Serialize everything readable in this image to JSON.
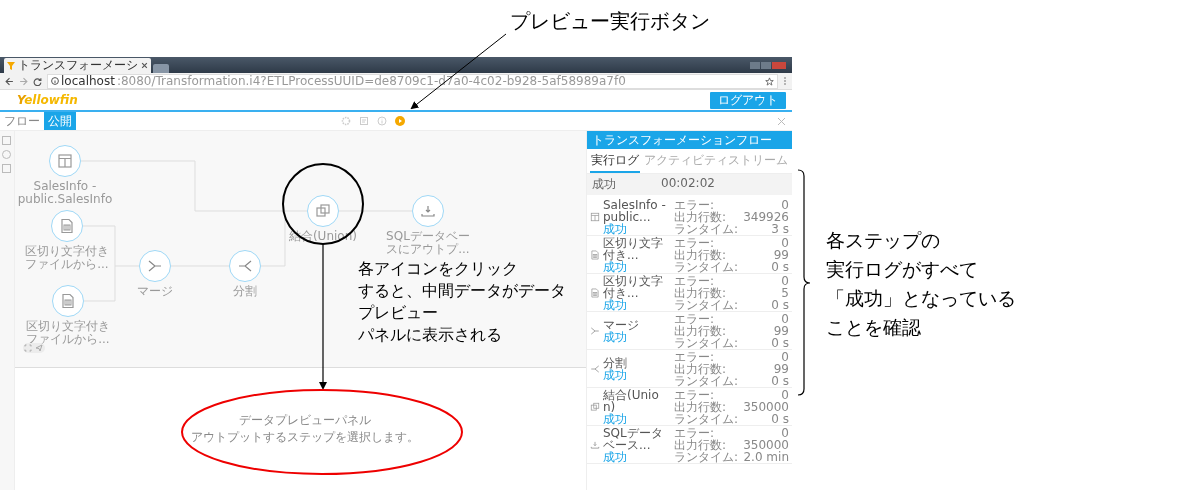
{
  "annotations": {
    "top_label": "プレビュー実行ボタン",
    "callout": [
      "各アイコンをクリック",
      "すると、中間データがデータ",
      "プレビュー",
      "パネルに表示される"
    ],
    "side_note": [
      "各ステップの",
      "実行ログがすべて",
      "「成功」となっている",
      "ことを確認"
    ]
  },
  "browser": {
    "tab_title": "トランスフォーメーシ",
    "url_host": "localhost",
    "url_rest": ":8080/Transformation.i4?ETLProcessUUID=de8709c1-d7a0-4c02-b928-5af58989a7f0"
  },
  "header": {
    "logo_initial": "Y",
    "logo_rest": "ellowfin",
    "logout": "ログアウト"
  },
  "toolbar": {
    "tabs": [
      {
        "label": "フロー",
        "selected": false
      },
      {
        "label": "公開",
        "selected": true
      }
    ]
  },
  "flow": {
    "nodes": [
      {
        "kind": "table",
        "label": [
          "SalesInfo -",
          "public.SalesInfo"
        ]
      },
      {
        "kind": "file",
        "label": [
          "区切り文字付き",
          "ファイルから..."
        ]
      },
      {
        "kind": "file",
        "label": [
          "区切り文字付き",
          "ファイルから..."
        ]
      },
      {
        "kind": "merge",
        "label": [
          "マージ"
        ]
      },
      {
        "kind": "split",
        "label": [
          "分割"
        ]
      },
      {
        "kind": "union",
        "label": [
          "結合(Union)"
        ]
      },
      {
        "kind": "output",
        "label": [
          "SQLデータベー",
          "スにアウトプ..."
        ]
      }
    ]
  },
  "preview": {
    "title": "データプレビューパネル",
    "hint": "アウトプットするステップを選択します。"
  },
  "panel": {
    "title": "トランスフォーメーションフロー",
    "tabs": [
      {
        "label": "実行ログ",
        "selected": true
      },
      {
        "label": "アクティビティストリーム",
        "selected": false
      }
    ],
    "summary": {
      "status": "成功",
      "time": "00:02:02"
    },
    "steps": [
      {
        "kind": "table",
        "name": "SalesInfo - public...",
        "status": "成功",
        "stats": [
          {
            "label": "エラー:",
            "value": "0"
          },
          {
            "label": "出力行数:",
            "value": "349926"
          },
          {
            "label": "ランタイム:",
            "value": "3 s"
          }
        ]
      },
      {
        "kind": "file",
        "name": "区切り文字付き...",
        "status": "成功",
        "stats": [
          {
            "label": "エラー:",
            "value": "0"
          },
          {
            "label": "出力行数:",
            "value": "99"
          },
          {
            "label": "ランタイム:",
            "value": "0 s"
          }
        ]
      },
      {
        "kind": "file",
        "name": "区切り文字付き...",
        "status": "成功",
        "stats": [
          {
            "label": "エラー:",
            "value": "0"
          },
          {
            "label": "出力行数:",
            "value": "5"
          },
          {
            "label": "ランタイム:",
            "value": "0 s"
          }
        ]
      },
      {
        "kind": "merge",
        "name": "マージ",
        "status": "成功",
        "stats": [
          {
            "label": "エラー:",
            "value": "0"
          },
          {
            "label": "出力行数:",
            "value": "99"
          },
          {
            "label": "ランタイム:",
            "value": "0 s"
          }
        ]
      },
      {
        "kind": "split",
        "name": "分割",
        "status": "成功",
        "stats": [
          {
            "label": "エラー:",
            "value": "0"
          },
          {
            "label": "出力行数:",
            "value": "99"
          },
          {
            "label": "ランタイム:",
            "value": "0 s"
          }
        ]
      },
      {
        "kind": "union",
        "name": "結合(Union)",
        "status": "成功",
        "stats": [
          {
            "label": "エラー:",
            "value": "0"
          },
          {
            "label": "出力行数:",
            "value": "350000"
          },
          {
            "label": "ランタイム:",
            "value": "0 s"
          }
        ]
      },
      {
        "kind": "output",
        "name": "SQLデータベース...",
        "status": "成功",
        "stats": [
          {
            "label": "エラー:",
            "value": "0"
          },
          {
            "label": "出力行数:",
            "value": "350000"
          },
          {
            "label": "ランタイム:",
            "value": "2.0 min"
          }
        ]
      }
    ]
  }
}
